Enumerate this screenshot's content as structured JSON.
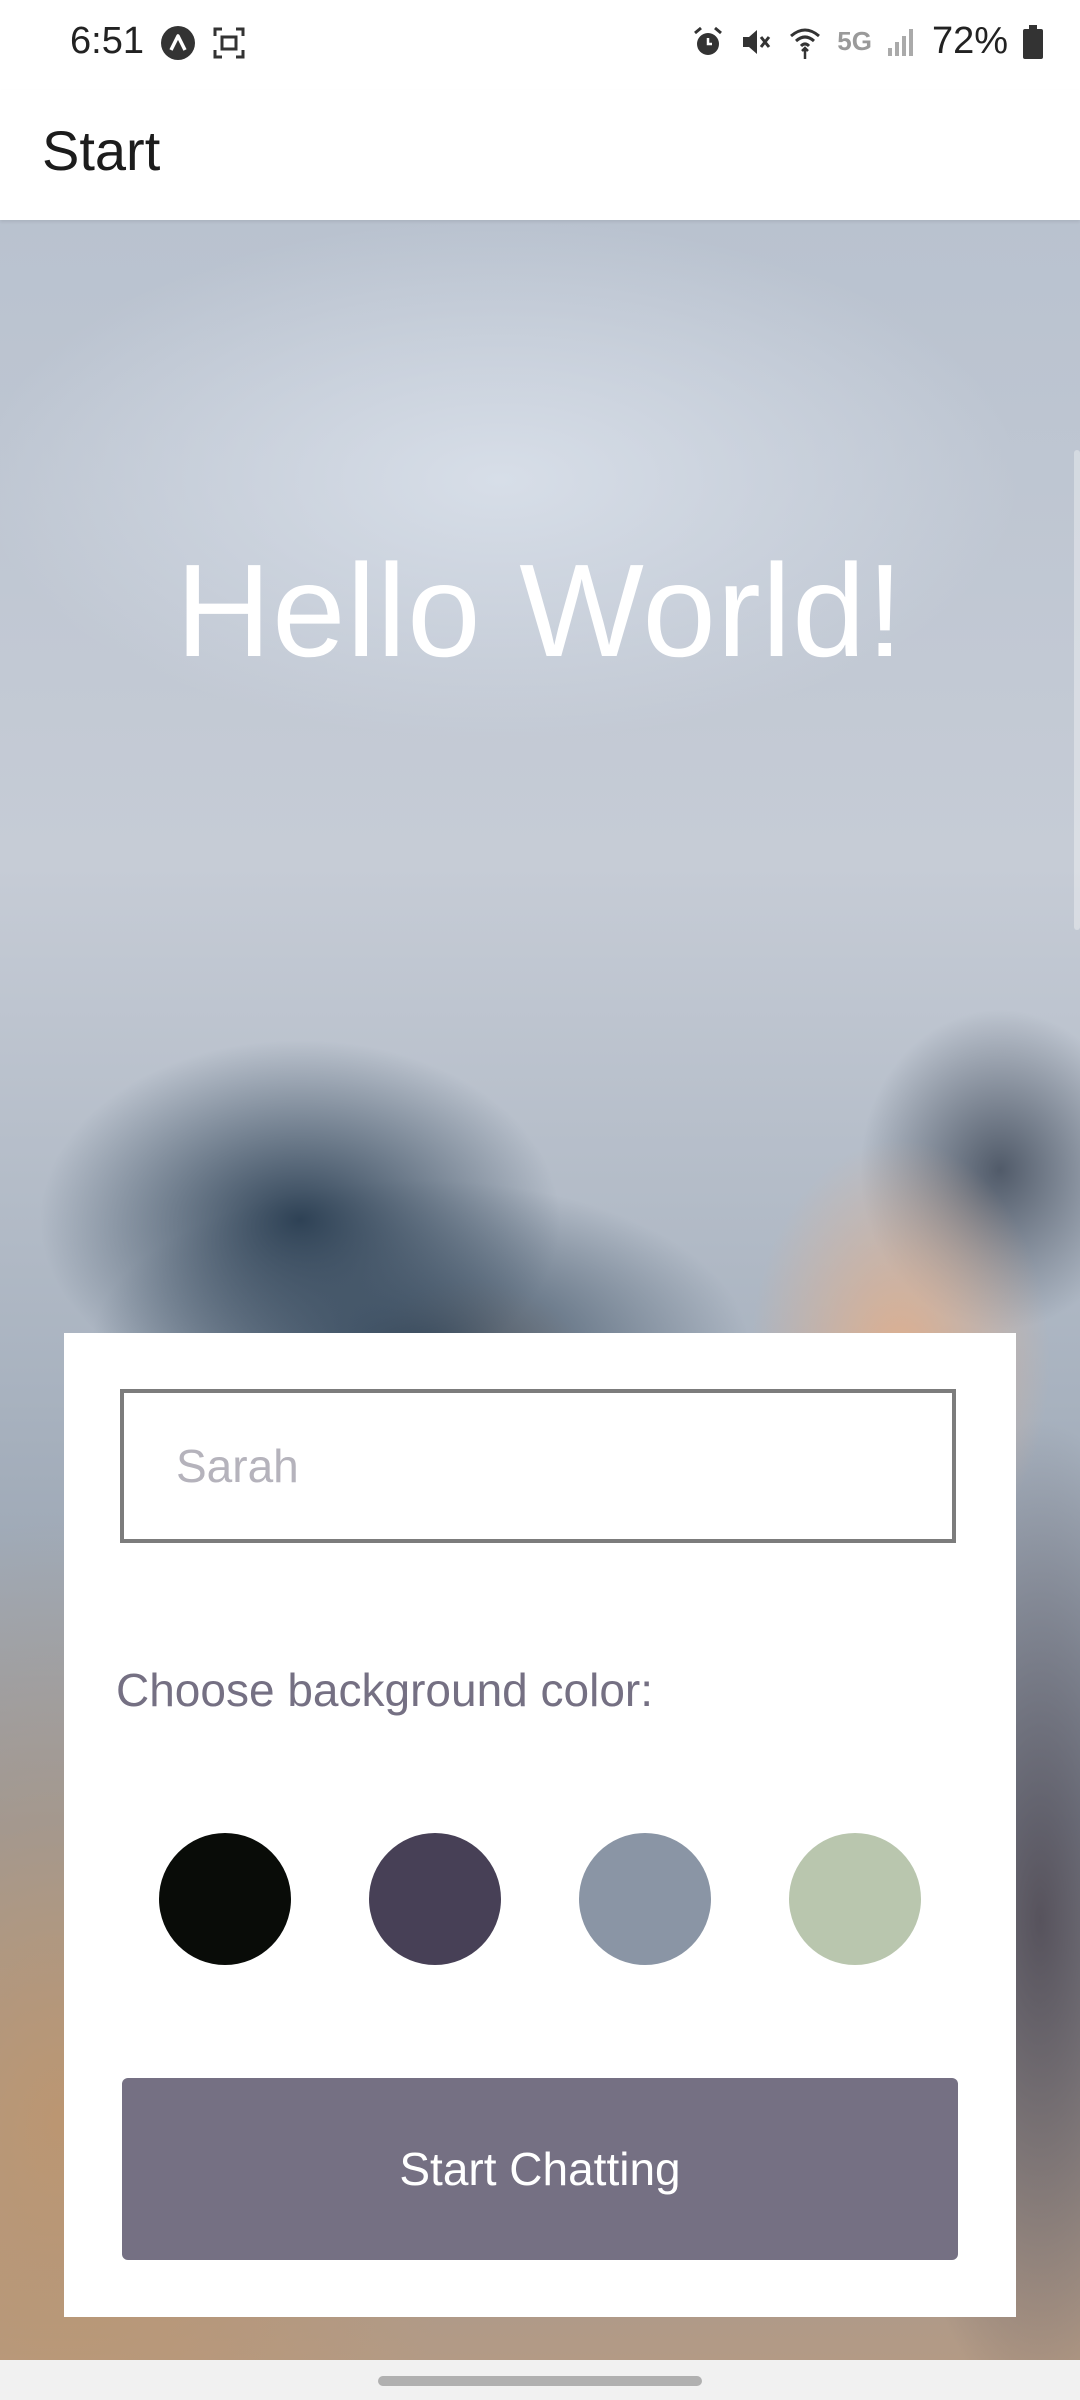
{
  "status_bar": {
    "time": "6:51",
    "network": "5G",
    "battery_percent": "72%"
  },
  "header": {
    "title": "Start"
  },
  "hero": {
    "title": "Hello World!"
  },
  "form": {
    "name_placeholder": "Sarah",
    "name_value": "",
    "color_label": "Choose background color:",
    "colors": [
      "#090C08",
      "#474056",
      "#8A95A5",
      "#B9C6AE"
    ],
    "button_label": "Start Chatting",
    "button_color": "#757083"
  }
}
